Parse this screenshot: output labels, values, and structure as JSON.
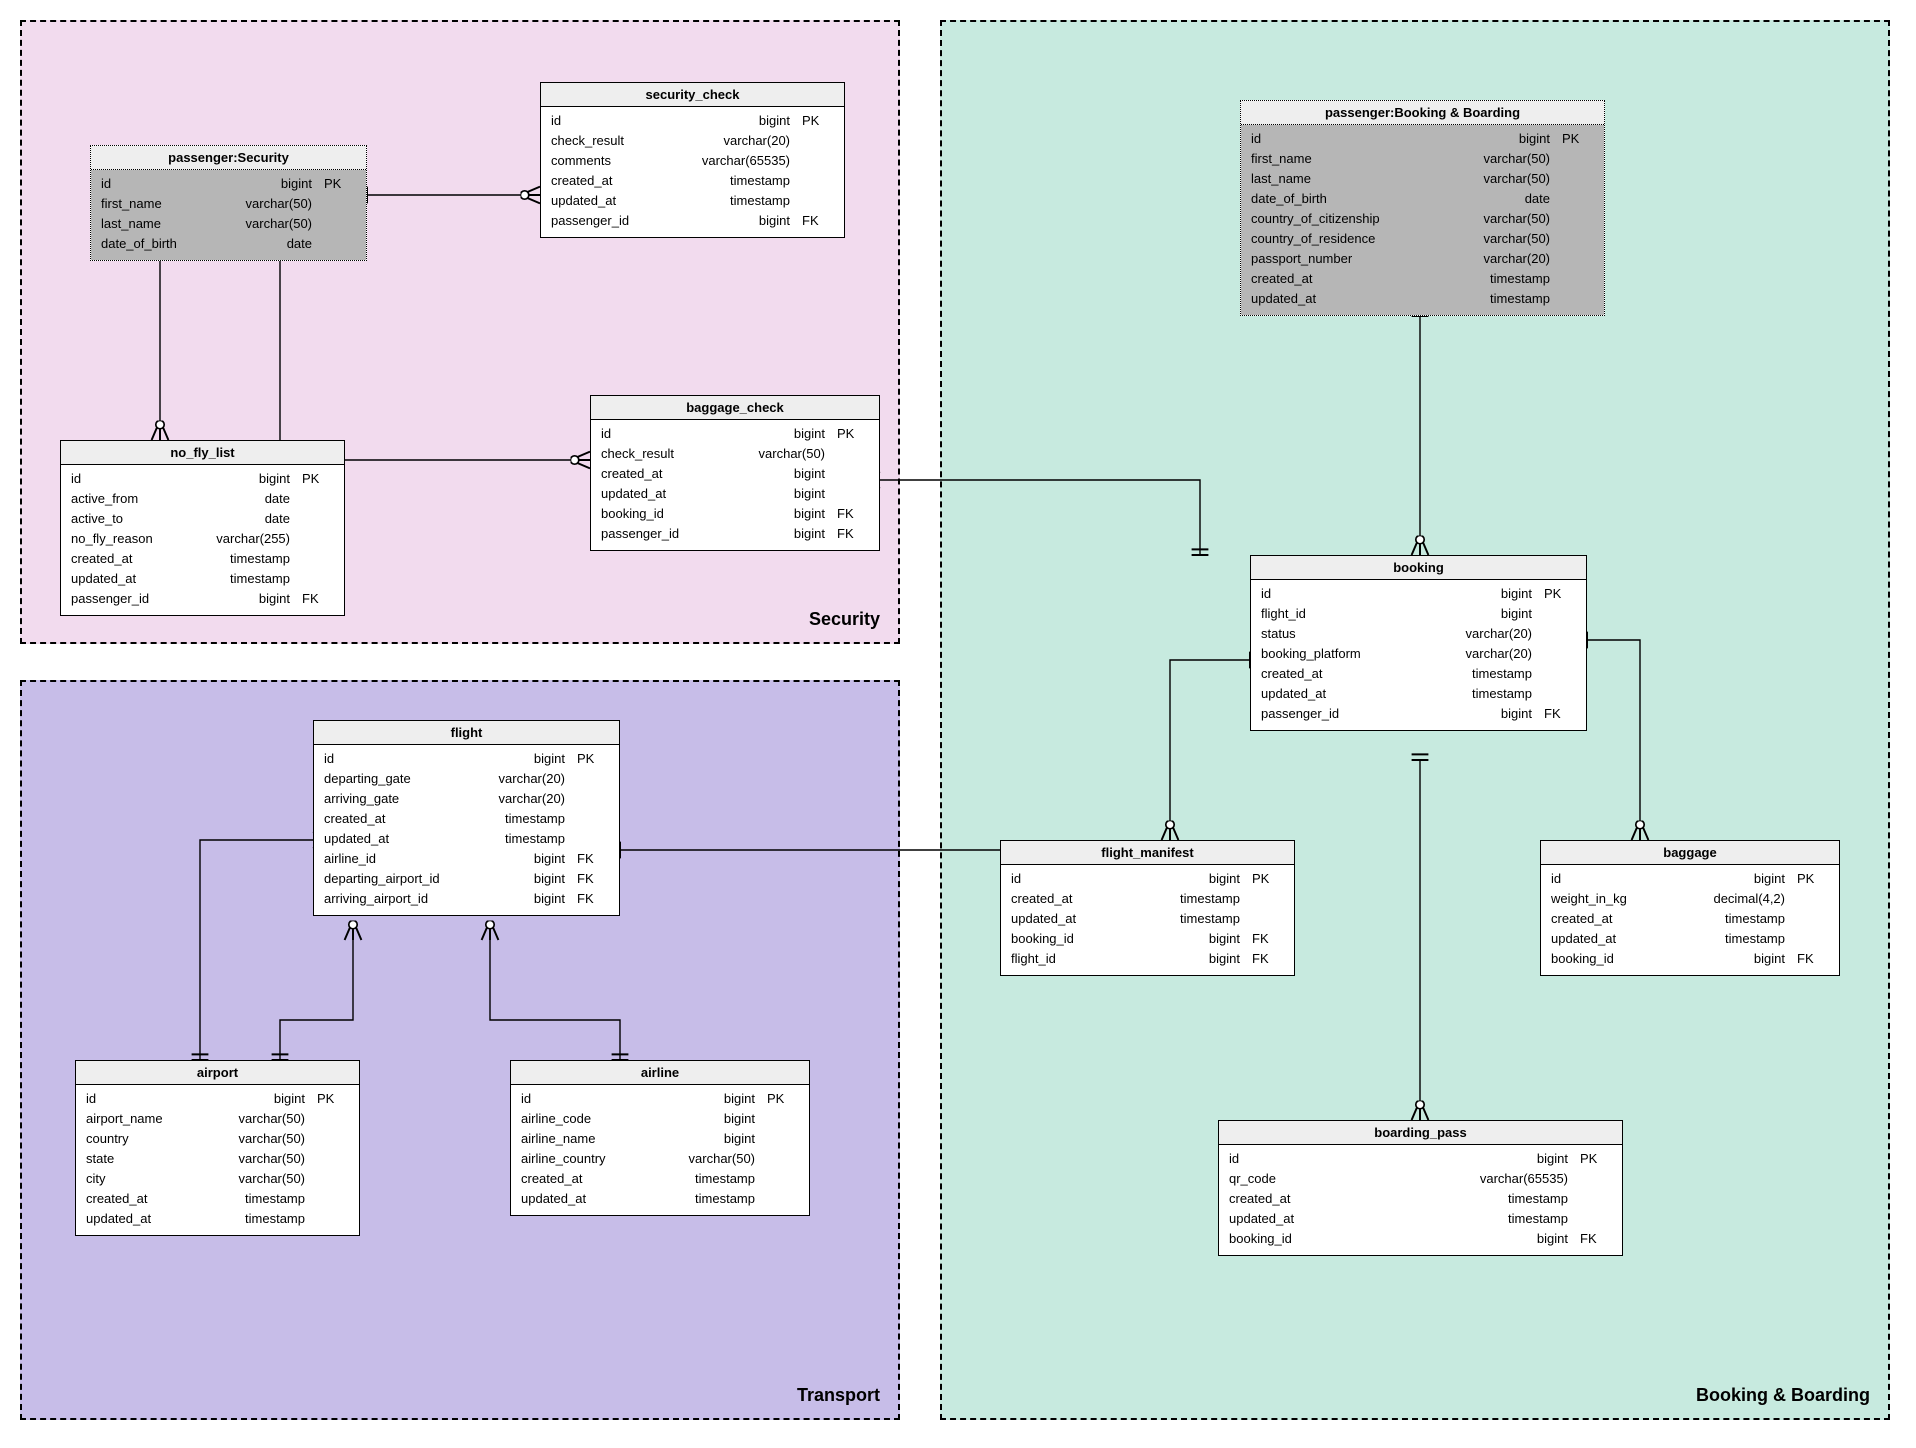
{
  "regions": {
    "security": {
      "label": "Security",
      "bg": "#f2dbee"
    },
    "transport": {
      "label": "Transport",
      "bg": "#c7bde8"
    },
    "booking": {
      "label": "Booking & Boarding",
      "bg": "#c7eadf"
    }
  },
  "entities": {
    "passenger_security": {
      "title": "passenger:Security",
      "rows": [
        {
          "name": "id",
          "type": "bigint",
          "key": "PK"
        },
        {
          "name": "first_name",
          "type": "varchar(50)",
          "key": ""
        },
        {
          "name": "last_name",
          "type": "varchar(50)",
          "key": ""
        },
        {
          "name": "date_of_birth",
          "type": "date",
          "key": ""
        }
      ]
    },
    "security_check": {
      "title": "security_check",
      "rows": [
        {
          "name": "id",
          "type": "bigint",
          "key": "PK"
        },
        {
          "name": "check_result",
          "type": "varchar(20)",
          "key": ""
        },
        {
          "name": "comments",
          "type": "varchar(65535)",
          "key": ""
        },
        {
          "name": "created_at",
          "type": "timestamp",
          "key": ""
        },
        {
          "name": "updated_at",
          "type": "timestamp",
          "key": ""
        },
        {
          "name": "passenger_id",
          "type": "bigint",
          "key": "FK"
        }
      ]
    },
    "no_fly_list": {
      "title": "no_fly_list",
      "rows": [
        {
          "name": "id",
          "type": "bigint",
          "key": "PK"
        },
        {
          "name": "active_from",
          "type": "date",
          "key": ""
        },
        {
          "name": "active_to",
          "type": "date",
          "key": ""
        },
        {
          "name": "no_fly_reason",
          "type": "varchar(255)",
          "key": ""
        },
        {
          "name": "created_at",
          "type": "timestamp",
          "key": ""
        },
        {
          "name": "updated_at",
          "type": "timestamp",
          "key": ""
        },
        {
          "name": "passenger_id",
          "type": "bigint",
          "key": "FK"
        }
      ]
    },
    "baggage_check": {
      "title": "baggage_check",
      "rows": [
        {
          "name": "id",
          "type": "bigint",
          "key": "PK"
        },
        {
          "name": "check_result",
          "type": "varchar(50)",
          "key": ""
        },
        {
          "name": "created_at",
          "type": "bigint",
          "key": ""
        },
        {
          "name": "updated_at",
          "type": "bigint",
          "key": ""
        },
        {
          "name": "booking_id",
          "type": "bigint",
          "key": "FK"
        },
        {
          "name": "passenger_id",
          "type": "bigint",
          "key": "FK"
        }
      ]
    },
    "passenger_booking": {
      "title": "passenger:Booking & Boarding",
      "rows": [
        {
          "name": "id",
          "type": "bigint",
          "key": "PK"
        },
        {
          "name": "first_name",
          "type": "varchar(50)",
          "key": ""
        },
        {
          "name": "last_name",
          "type": "varchar(50)",
          "key": ""
        },
        {
          "name": "date_of_birth",
          "type": "date",
          "key": ""
        },
        {
          "name": "country_of_citizenship",
          "type": "varchar(50)",
          "key": ""
        },
        {
          "name": "country_of_residence",
          "type": "varchar(50)",
          "key": ""
        },
        {
          "name": "passport_number",
          "type": "varchar(20)",
          "key": ""
        },
        {
          "name": "created_at",
          "type": "timestamp",
          "key": ""
        },
        {
          "name": "updated_at",
          "type": "timestamp",
          "key": ""
        }
      ]
    },
    "booking": {
      "title": "booking",
      "rows": [
        {
          "name": "id",
          "type": "bigint",
          "key": "PK"
        },
        {
          "name": "flight_id",
          "type": "bigint",
          "key": ""
        },
        {
          "name": "status",
          "type": "varchar(20)",
          "key": ""
        },
        {
          "name": "booking_platform",
          "type": "varchar(20)",
          "key": ""
        },
        {
          "name": "created_at",
          "type": "timestamp",
          "key": ""
        },
        {
          "name": "updated_at",
          "type": "timestamp",
          "key": ""
        },
        {
          "name": "passenger_id",
          "type": "bigint",
          "key": "FK"
        }
      ]
    },
    "flight_manifest": {
      "title": "flight_manifest",
      "rows": [
        {
          "name": "id",
          "type": "bigint",
          "key": "PK"
        },
        {
          "name": "created_at",
          "type": "timestamp",
          "key": ""
        },
        {
          "name": "updated_at",
          "type": "timestamp",
          "key": ""
        },
        {
          "name": "booking_id",
          "type": "bigint",
          "key": "FK"
        },
        {
          "name": "flight_id",
          "type": "bigint",
          "key": "FK"
        }
      ]
    },
    "baggage": {
      "title": "baggage",
      "rows": [
        {
          "name": "id",
          "type": "bigint",
          "key": "PK"
        },
        {
          "name": "weight_in_kg",
          "type": "decimal(4,2)",
          "key": ""
        },
        {
          "name": "created_at",
          "type": "timestamp",
          "key": ""
        },
        {
          "name": "updated_at",
          "type": "timestamp",
          "key": ""
        },
        {
          "name": "booking_id",
          "type": "bigint",
          "key": "FK"
        }
      ]
    },
    "boarding_pass": {
      "title": "boarding_pass",
      "rows": [
        {
          "name": "id",
          "type": "bigint",
          "key": "PK"
        },
        {
          "name": "qr_code",
          "type": "varchar(65535)",
          "key": ""
        },
        {
          "name": "created_at",
          "type": "timestamp",
          "key": ""
        },
        {
          "name": "updated_at",
          "type": "timestamp",
          "key": ""
        },
        {
          "name": "booking_id",
          "type": "bigint",
          "key": "FK"
        }
      ]
    },
    "flight": {
      "title": "flight",
      "rows": [
        {
          "name": "id",
          "type": "bigint",
          "key": "PK"
        },
        {
          "name": "departing_gate",
          "type": "varchar(20)",
          "key": ""
        },
        {
          "name": "arriving_gate",
          "type": "varchar(20)",
          "key": ""
        },
        {
          "name": "created_at",
          "type": "timestamp",
          "key": ""
        },
        {
          "name": "updated_at",
          "type": "timestamp",
          "key": ""
        },
        {
          "name": "airline_id",
          "type": "bigint",
          "key": "FK"
        },
        {
          "name": "departing_airport_id",
          "type": "bigint",
          "key": "FK"
        },
        {
          "name": "arriving_airport_id",
          "type": "bigint",
          "key": "FK"
        }
      ]
    },
    "airport": {
      "title": "airport",
      "rows": [
        {
          "name": "id",
          "type": "bigint",
          "key": "PK"
        },
        {
          "name": "airport_name",
          "type": "varchar(50)",
          "key": ""
        },
        {
          "name": "country",
          "type": "varchar(50)",
          "key": ""
        },
        {
          "name": "state",
          "type": "varchar(50)",
          "key": ""
        },
        {
          "name": "city",
          "type": "varchar(50)",
          "key": ""
        },
        {
          "name": "created_at",
          "type": "timestamp",
          "key": ""
        },
        {
          "name": "updated_at",
          "type": "timestamp",
          "key": ""
        }
      ]
    },
    "airline": {
      "title": "airline",
      "rows": [
        {
          "name": "id",
          "type": "bigint",
          "key": "PK"
        },
        {
          "name": "airline_code",
          "type": "bigint",
          "key": ""
        },
        {
          "name": "airline_name",
          "type": "bigint",
          "key": ""
        },
        {
          "name": "airline_country",
          "type": "varchar(50)",
          "key": ""
        },
        {
          "name": "created_at",
          "type": "timestamp",
          "key": ""
        },
        {
          "name": "updated_at",
          "type": "timestamp",
          "key": ""
        }
      ]
    }
  }
}
